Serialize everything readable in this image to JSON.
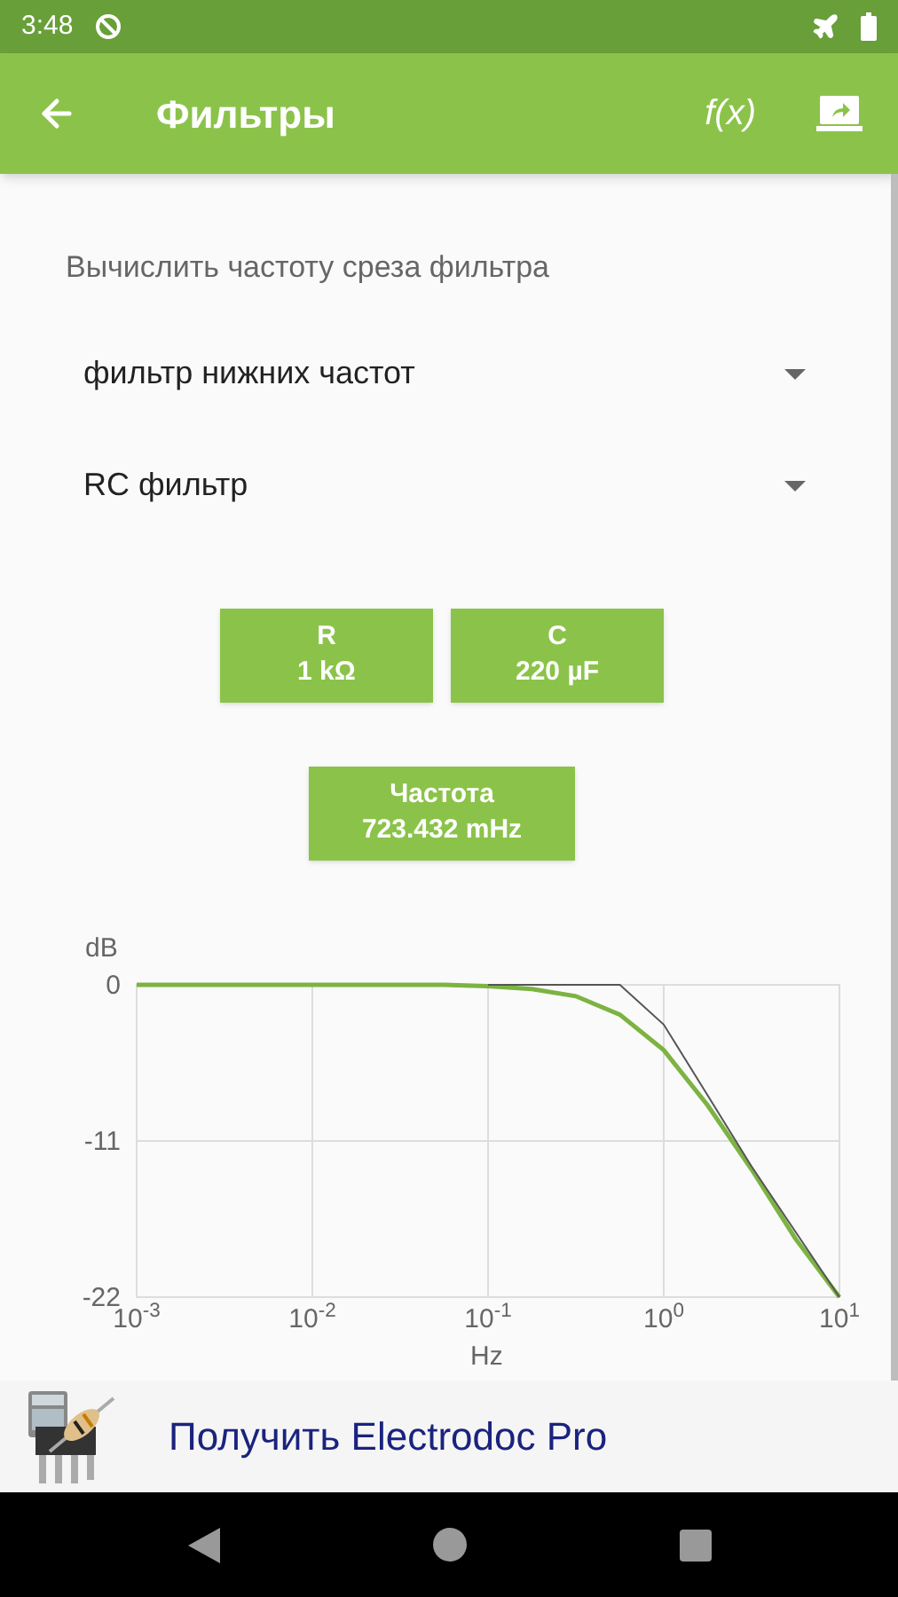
{
  "status_bar": {
    "time": "3:48"
  },
  "app_bar": {
    "title": "Фильтры",
    "function_label": "f(x)"
  },
  "heading": "Вычислить частоту среза фильтра",
  "dropdowns": [
    {
      "value": "фильтр нижних частот"
    },
    {
      "value": "RC фильтр"
    }
  ],
  "inputs": [
    {
      "label": "R",
      "value": "1 kΩ"
    },
    {
      "label": "C",
      "value": "220 µF"
    }
  ],
  "result": {
    "label": "Частота",
    "value": "723.432 mHz"
  },
  "chart_data": {
    "type": "line",
    "xlabel": "Hz",
    "ylabel": "dB",
    "categories": [
      "10$^{-3}$",
      null,
      null,
      null,
      "10$^{-2}$",
      null,
      null,
      null,
      "10$^{-1}$",
      null,
      null,
      null,
      "10$^{0}$",
      null,
      null,
      null,
      "10$^{1}$"
    ],
    "series": [
      {
        "color": "#7cb342",
        "values": [
          0,
          0,
          0,
          0,
          0,
          0,
          0,
          0,
          -0.1,
          -0.3,
          -0.8,
          -2.1,
          -4.6,
          -8.5,
          -13,
          -17.9,
          -22
        ]
      },
      {
        "color": "#555555",
        "values": [
          null,
          null,
          null,
          null,
          null,
          null,
          null,
          null,
          0,
          0,
          0,
          0,
          -2.8,
          -7.8,
          -12.8,
          null,
          -22
        ]
      }
    ],
    "ylim": [
      -22,
      0
    ],
    "yticks": [
      0,
      -11,
      -22
    ],
    "grid": true
  },
  "promo": {
    "text": "Получить Electrodoc Pro"
  }
}
